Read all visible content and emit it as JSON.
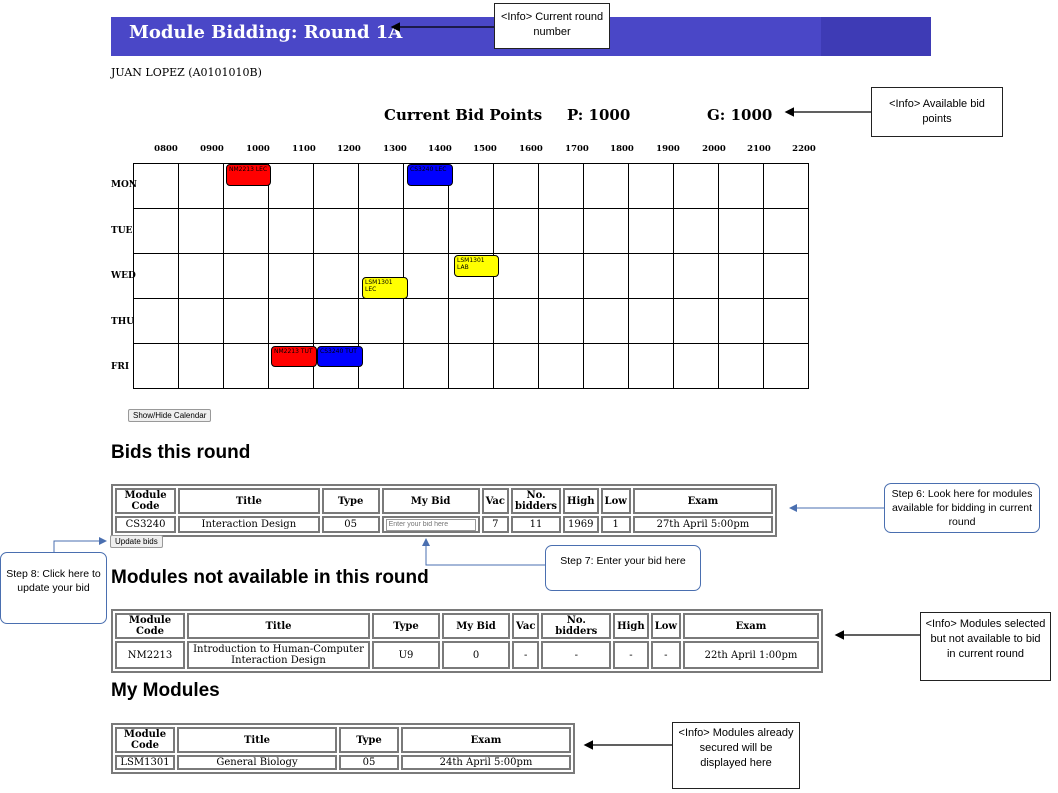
{
  "banner": {
    "title": "Module Bidding: Round 1A"
  },
  "student": {
    "name": "JUAN LOPEZ (A0101010B)"
  },
  "bid_points": {
    "label": "Current Bid Points",
    "p": "P: 1000",
    "g": "G: 1000"
  },
  "calendar": {
    "hours": [
      "0800",
      "0900",
      "1000",
      "1100",
      "1200",
      "1300",
      "1400",
      "1500",
      "1600",
      "1700",
      "1800",
      "1900",
      "2000",
      "2100",
      "2200"
    ],
    "days": [
      "MON",
      "TUE",
      "WED",
      "THU",
      "FRI"
    ],
    "slots": [
      {
        "day": "MON",
        "text": "NM2213 LEC",
        "color": "#ff0000"
      },
      {
        "day": "MON",
        "text": "CS3240 LEC",
        "color": "#0000ff"
      },
      {
        "day": "WED",
        "text": "LSM1301 LEC",
        "color": "#ffff00"
      },
      {
        "day": "WED",
        "text": "LSM1301 LAB",
        "color": "#ffff00"
      },
      {
        "day": "FRI",
        "text": "NM2213 TUT",
        "color": "#ff0000"
      },
      {
        "day": "FRI",
        "text": "CS3240 TUT",
        "color": "#0000ff"
      }
    ],
    "toggle_label": "Show/Hide Calendar"
  },
  "bids": {
    "heading": "Bids this round",
    "headers": [
      "Module Code",
      "Title",
      "Type",
      "My Bid",
      "Vac",
      "No. bidders",
      "High",
      "Low",
      "Exam"
    ],
    "row": {
      "code": "CS3240",
      "title": "Interaction Design",
      "type": "05",
      "bid_placeholder": "Enter your bid here",
      "vac": "7",
      "bidders": "11",
      "high": "1969",
      "low": "1",
      "exam": "27th April 5:00pm"
    },
    "update_label": "Update bids"
  },
  "unavailable": {
    "heading": "Modules not available in this round",
    "headers": [
      "Module Code",
      "Title",
      "Type",
      "My Bid",
      "Vac",
      "No. bidders",
      "High",
      "Low",
      "Exam"
    ],
    "row": {
      "code": "NM2213",
      "title": "Introduction to Human-Computer Interaction Design",
      "type": "U9",
      "bid": "0",
      "vac": "-",
      "bidders": "-",
      "high": "-",
      "low": "-",
      "exam": "22th April 1:00pm"
    }
  },
  "my_modules": {
    "heading": "My Modules",
    "headers": [
      "Module Code",
      "Title",
      "Type",
      "Exam"
    ],
    "row": {
      "code": "LSM1301",
      "title": "General Biology",
      "type": "05",
      "exam": "24th April 5:00pm"
    }
  },
  "annotations": {
    "round": "<Info> Current round number",
    "points": "<Info> Available bid points",
    "step6": "Step 6: Look here for modules available for bidding in current round",
    "step7": "Step 7: Enter your bid here",
    "step8": "Step 8: Click here to update your bid",
    "not_available": "<Info> Modules selected but not available to bid in current round",
    "secured": "<Info> Modules already secured will be displayed here"
  }
}
